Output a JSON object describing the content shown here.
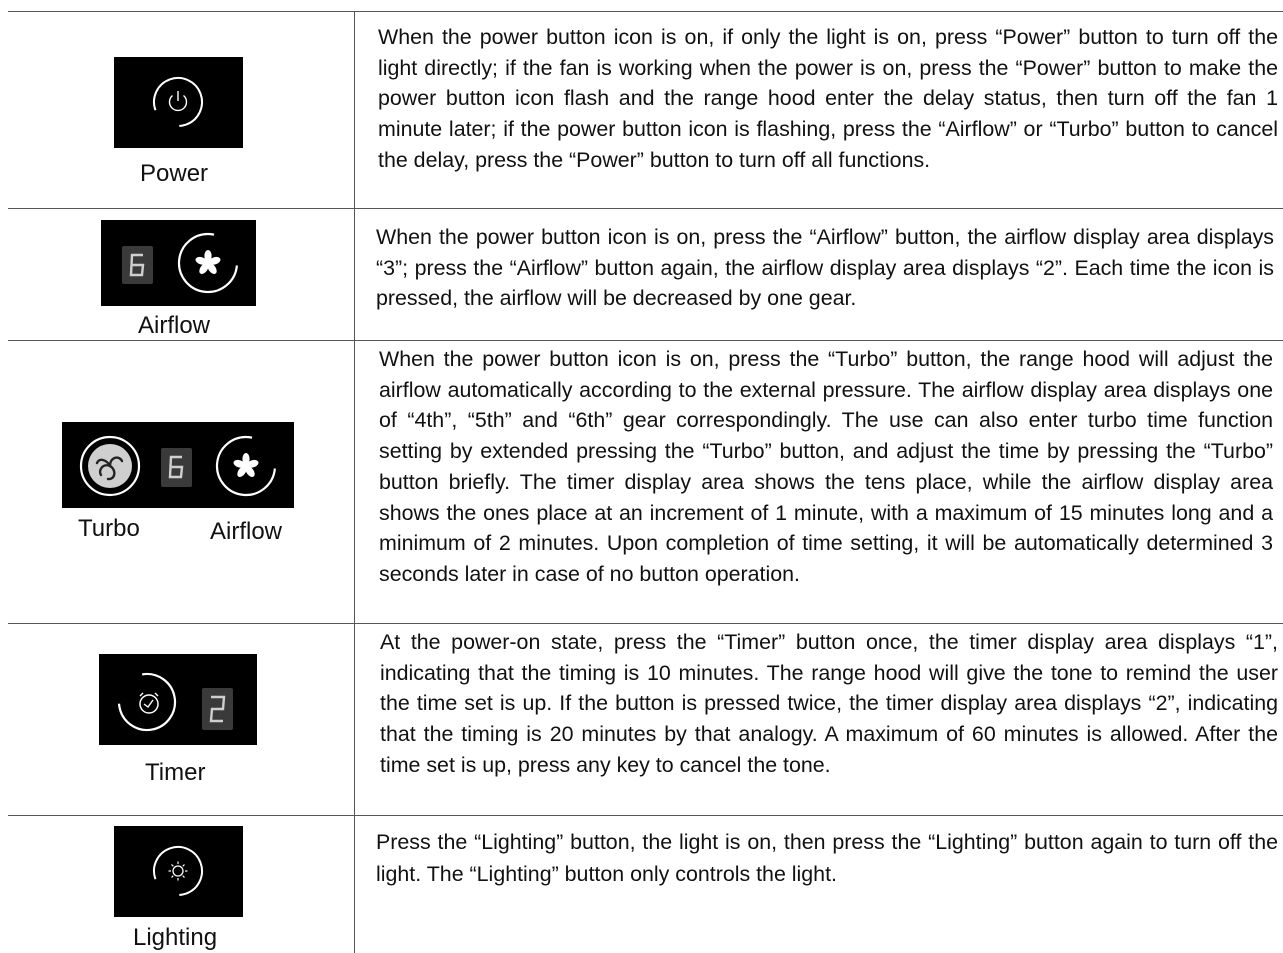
{
  "rows": [
    {
      "label": "Power",
      "icon": "power-icon",
      "description": "When the power button icon is on, if only the light is on, press “Power” button to turn off the light directly; if the fan is working when the power is on, press the “Power” button to make the power button icon flash and the range hood enter the delay status, then turn off the fan 1 minute later; if the power button icon is flashing, press the “Airflow” or “Turbo” button to cancel the delay, press the “Power” button to turn off all functions."
    },
    {
      "label": "Airflow",
      "icon": "fan-icon",
      "display_digit": "6",
      "description": "When the power button icon is on, press the “Airflow” button, the airflow display area displays “3”; press the “Airflow” button again, the airflow display area displays “2”. Each time the icon is pressed, the airflow will be decreased by one gear."
    },
    {
      "label_turbo": "Turbo",
      "label_airflow": "Airflow",
      "icon_turbo": "turbo-swirl-icon",
      "icon_airflow": "fan-icon",
      "display_digit": "6",
      "description": "When the power button icon is on, press the “Turbo” button, the range hood will adjust the airflow automatically according to the external pressure. The airflow display area displays one of “4th”, “5th” and “6th” gear correspondingly. The use can also enter turbo time function setting by extended pressing the “Turbo” button, and adjust the time by pressing the “Turbo” button briefly. The timer display area shows the tens place, while the airflow display area shows the ones place at an increment of 1 minute, with a maximum of 15 minutes long and a minimum of 2 minutes. Upon completion of time setting, it will be automatically determined 3 seconds later in case of no button operation."
    },
    {
      "label": "Timer",
      "icon": "timer-icon",
      "display_digit": "2",
      "description": "At the power-on state, press the “Timer” button once, the timer display area displays “1”, indicating that the timing is 10 minutes. The range hood will give the tone to remind the user the time set is up. If the button is pressed twice, the timer display area displays “2”, indicating that the timing is 20 minutes by that analogy. A maximum of 60 minutes is allowed. After the time set is up, press any key to cancel the tone."
    },
    {
      "label": "Lighting",
      "icon": "light-bulb-icon",
      "description": "Press the “Lighting” button, the light is on, then press the “Lighting” button again to turn off the light. The “Lighting” button only controls the light."
    }
  ]
}
